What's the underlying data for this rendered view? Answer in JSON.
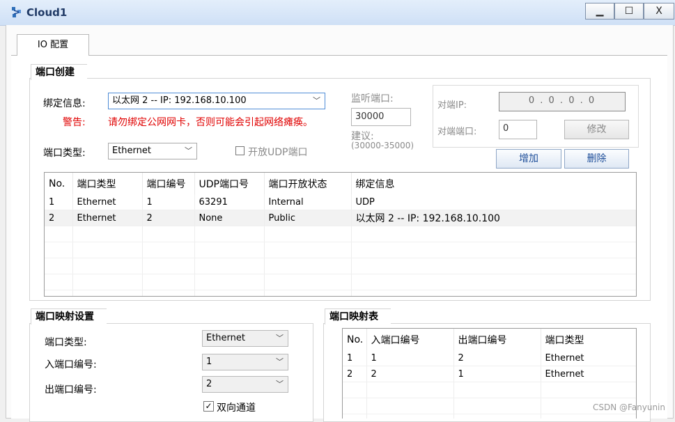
{
  "window": {
    "title": "Cloud1",
    "min": "▁",
    "max": "☐",
    "close": "X"
  },
  "tab": {
    "label": "IO 配置"
  },
  "port_create": {
    "title": "端口创建",
    "bind_label": "绑定信息:",
    "bind_value": "以太网 2 -- IP: 192.168.10.100",
    "warn_label": "警告:",
    "warn_text": "请勿绑定公网网卡，否则可能会引起网络瘫痪。",
    "type_label": "端口类型:",
    "type_value": "Ethernet",
    "udp_label": "开放UDP端口",
    "listen_label": "监听端口:",
    "listen_value": "30000",
    "suggest_label": "建议:",
    "suggest_range": "(30000-35000)",
    "peer_ip_label": "对端IP:",
    "peer_ip_value": "0 . 0 . 0 . 0",
    "peer_port_label": "对端端口:",
    "peer_port_value": "0",
    "modify_btn": "修改",
    "add_btn": "增加",
    "delete_btn": "删除",
    "table": {
      "headers": [
        "No.",
        "端口类型",
        "端口编号",
        "UDP端口号",
        "端口开放状态",
        "绑定信息"
      ],
      "rows": [
        [
          "1",
          "Ethernet",
          "1",
          "63291",
          "Internal",
          "UDP"
        ],
        [
          "2",
          "Ethernet",
          "2",
          "None",
          "Public",
          "以太网 2 -- IP: 192.168.10.100"
        ]
      ]
    }
  },
  "mapping_settings": {
    "title": "端口映射设置",
    "type_label": "端口类型:",
    "type_value": "Ethernet",
    "in_label": "入端口编号:",
    "in_value": "1",
    "out_label": "出端口编号:",
    "out_value": "2",
    "bidir_label": "双向通道",
    "bidir_mark": "✓"
  },
  "mapping_table": {
    "title": "端口映射表",
    "headers": [
      "No.",
      "入端口编号",
      "出端口编号",
      "端口类型"
    ],
    "rows": [
      [
        "1",
        "1",
        "2",
        "Ethernet"
      ],
      [
        "2",
        "2",
        "1",
        "Ethernet"
      ]
    ]
  },
  "watermark": "CSDN @Fanyunin"
}
